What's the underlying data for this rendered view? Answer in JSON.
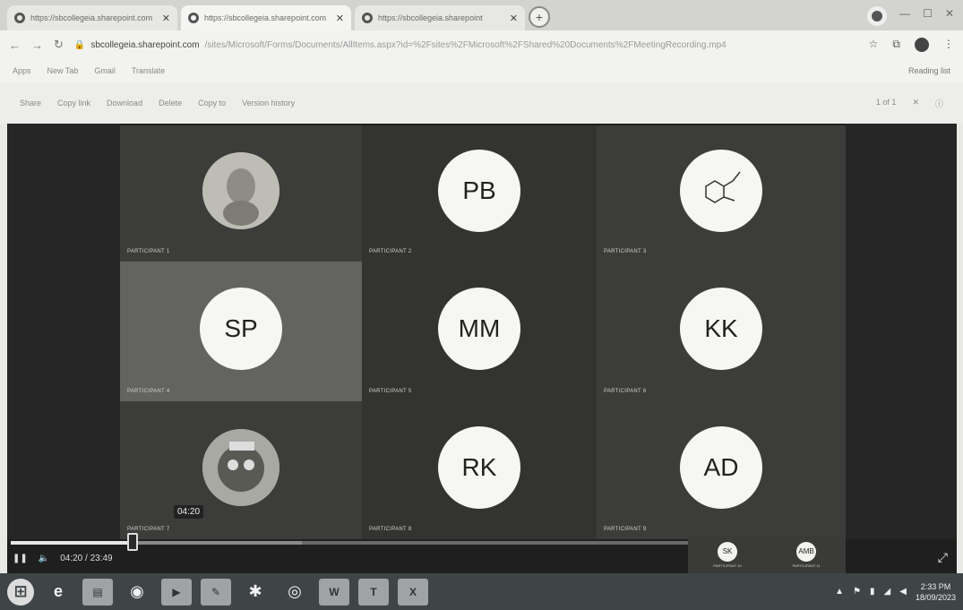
{
  "browser": {
    "tabs": [
      {
        "title": "https://sbcollegeia.sharepoint.com",
        "active": false
      },
      {
        "title": "https://sbcollegeia.sharepoint.com",
        "active": true
      },
      {
        "title": "https://sbcollegeia.sharepoint",
        "active": false
      }
    ],
    "new_tab": "+",
    "address": {
      "domain": "sbcollegeia.sharepoint.com",
      "path": "/sites/Microsoft/Forms/Documents/AllItems.aspx?id=%2Fsites%2FMicrosoft%2FShared%20Documents%2FMeetingRecording.mp4"
    },
    "bookmarks": [
      "Apps",
      "New Tab",
      "Gmail",
      "Translate"
    ],
    "reading_list": "Reading list",
    "toolbar": {
      "items": [
        "Share",
        "Copy link",
        "Download",
        "Delete",
        "Copy to",
        "Version history"
      ],
      "page_indicator": "1 of 1",
      "close": "✕"
    }
  },
  "meeting": {
    "tiles": [
      {
        "initials": "",
        "name": "Participant 1",
        "type": "photo"
      },
      {
        "initials": "PB",
        "name": "Participant 2",
        "type": "initials"
      },
      {
        "initials": "",
        "name": "Participant 3",
        "type": "molecule"
      },
      {
        "initials": "SP",
        "name": "Participant 4",
        "type": "initials",
        "highlight": true
      },
      {
        "initials": "MM",
        "name": "Participant 5",
        "type": "initials"
      },
      {
        "initials": "KK",
        "name": "Participant 6",
        "type": "initials"
      },
      {
        "initials": "",
        "name": "Participant 7",
        "type": "photo"
      },
      {
        "initials": "RK",
        "name": "Participant 8",
        "type": "initials"
      },
      {
        "initials": "AD",
        "name": "Participant 9",
        "type": "initials"
      }
    ],
    "strip": [
      {
        "initials": "SK",
        "name": "Participant 10"
      },
      {
        "initials": "AMB",
        "name": "Participant 11"
      }
    ]
  },
  "player": {
    "tooltip": "04:20",
    "time_display": "04:20 / 23:49",
    "progress": 0.18,
    "loaded": 0.43
  },
  "taskbar": {
    "time": "2:33 PM",
    "date": "18/09/2023"
  }
}
